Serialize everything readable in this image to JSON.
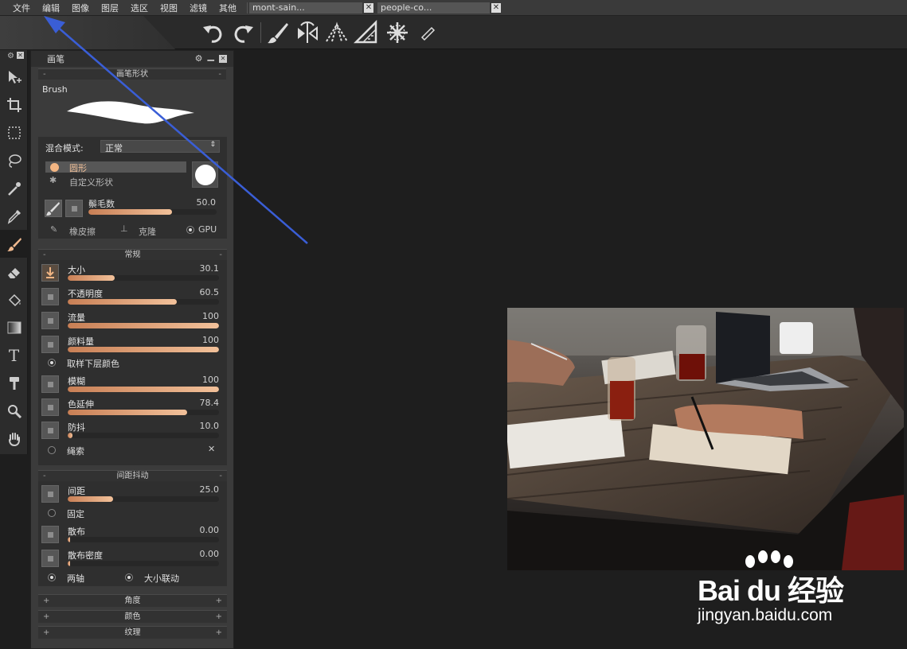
{
  "menu": [
    "文件",
    "编辑",
    "图像",
    "图层",
    "选区",
    "视图",
    "滤镜",
    "其他"
  ],
  "doc_tabs": [
    {
      "label": "mont-sain..."
    },
    {
      "label": "people-co..."
    }
  ],
  "panel": {
    "title": "画笔",
    "brush_shape_header": "画笔形状",
    "brush_name": "Brush",
    "blend_mode_label": "混合模式:",
    "blend_mode_value": "正常",
    "shape_round": "圆形",
    "shape_custom": "自定义形状",
    "bristles": {
      "label": "鬃毛数",
      "value": "50.0",
      "fraction": 0.65
    },
    "eraser_label": "橡皮擦",
    "clone_label": "克隆",
    "gpu_label": "GPU",
    "general_header": "常规",
    "sliders": [
      {
        "label": "大小",
        "value": "30.1",
        "fraction": 0.31
      },
      {
        "label": "不透明度",
        "value": "60.5",
        "fraction": 0.72
      },
      {
        "label": "流量",
        "value": "100",
        "fraction": 1.0
      },
      {
        "label": "颜料量",
        "value": "100",
        "fraction": 1.0
      }
    ],
    "sample_below": "取样下层颜色",
    "sliders2": [
      {
        "label": "模糊",
        "value": "100",
        "fraction": 1.0
      },
      {
        "label": "色延伸",
        "value": "78.4",
        "fraction": 0.79
      },
      {
        "label": "防抖",
        "value": "10.0",
        "fraction": 0.03
      }
    ],
    "lasso_label": "绳索",
    "jitter_header": "间距抖动",
    "spacing": {
      "label": "间距",
      "value": "25.0",
      "fraction": 0.3
    },
    "fixed_label": "固定",
    "scatter": {
      "label": "散布",
      "value": "0.00",
      "fraction": 0.0
    },
    "scatter_density": {
      "label": "散布密度",
      "value": "0.00",
      "fraction": 0.0
    },
    "both_axes": "两轴",
    "size_link": "大小联动",
    "collapsed": [
      "角度",
      "颜色",
      "纹理"
    ]
  },
  "watermark": {
    "logo_text": "Bai du 经验",
    "url": "jingyan.baidu.com"
  },
  "colors": {
    "accent": "#f2c19a",
    "arrow": "#3a5ed6"
  }
}
